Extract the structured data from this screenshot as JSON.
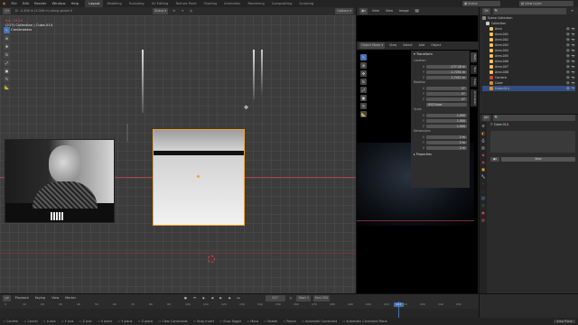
{
  "menu": {
    "items": [
      "File",
      "Edit",
      "Render",
      "Window",
      "Help"
    ]
  },
  "workspaces": [
    "Layout",
    "Modeling",
    "Sculpting",
    "UV Editing",
    "Texture Paint",
    "Shading",
    "Animation",
    "Rendering",
    "Compositing",
    "Scripting"
  ],
  "scene": {
    "label": "Scene",
    "view_layer": "View Layer"
  },
  "viewport": {
    "mode": "Object Mode",
    "orientation": "Global",
    "menus": [
      "View",
      "Select",
      "Add",
      "Object"
    ],
    "options": "Options",
    "info_line": "D: -4.306 m (4.306 m) along global X",
    "overlay_fps": "fps: 19.20",
    "overlay_collection": "(217) Collection | Cube.014",
    "overlay_units": "10 Centimeters"
  },
  "camera_view": {
    "menus": [
      "View",
      "Select",
      "Add",
      "Object"
    ],
    "mode": "Object Mode",
    "orientation": "Global",
    "header_menus": [
      "View",
      "View",
      "Image"
    ]
  },
  "n_panel": {
    "title": "Transform",
    "location_label": "Location",
    "location": [
      {
        "axis": "X",
        "value": "-177.18 m"
      },
      {
        "axis": "Y",
        "value": "-1.7251 m"
      },
      {
        "axis": "Z",
        "value": "1.7411 m"
      }
    ],
    "rotation_label": "Rotation",
    "rotation": [
      {
        "axis": "X",
        "value": "0°"
      },
      {
        "axis": "Y",
        "value": "0°"
      },
      {
        "axis": "Z",
        "value": "0°"
      }
    ],
    "rotation_mode": "XYZ Euler",
    "scale_label": "Scale",
    "scale": [
      {
        "axis": "X",
        "value": "1.000"
      },
      {
        "axis": "Y",
        "value": "1.000"
      },
      {
        "axis": "Z",
        "value": "1.000"
      }
    ],
    "dimensions_label": "Dimensions",
    "dimensions": [
      {
        "axis": "X",
        "value": "2 m"
      },
      {
        "axis": "Y",
        "value": "2 m"
      },
      {
        "axis": "Z",
        "value": "2 m"
      }
    ],
    "properties_label": "Properties",
    "tabs": [
      "Item",
      "Tool",
      "View",
      "Animation"
    ]
  },
  "outliner": {
    "root": "Scene Collection",
    "collection": "Collection",
    "items": [
      "Area",
      "Area.001",
      "Area.002",
      "Area.003",
      "Area.004",
      "Area.005",
      "Area.006",
      "Area.007",
      "Area.008",
      "Camera",
      "Cube",
      "Cube.014"
    ]
  },
  "properties": {
    "object_name": "Cube.014",
    "new_button": "New"
  },
  "timeline": {
    "menus": [
      "Playback",
      "Keying",
      "View",
      "Marker"
    ],
    "current_frame": "217",
    "start_label": "Start",
    "start": "1",
    "end_label": "End",
    "end": "250",
    "ticks": [
      "0",
      "10",
      "20",
      "30",
      "40",
      "50",
      "60",
      "70",
      "80",
      "90",
      "100",
      "110",
      "120",
      "130",
      "140",
      "150",
      "160",
      "170",
      "180",
      "190",
      "200",
      "210",
      "220",
      "230",
      "240",
      "250"
    ]
  },
  "status_bar": {
    "items": [
      "Confirm",
      "Cancel",
      "X axis",
      "Y axis",
      "Z axis",
      "X plane",
      "Y plane",
      "Z plane",
      "Clear Constraints",
      "Snap Invert",
      "Snap Toggle",
      "Move",
      "Rotate",
      "Resize",
      "Automatic Constraint",
      "Automatic Constraint Plane"
    ],
    "right": "Area Plane"
  },
  "colors": {
    "accent": "#4772b3",
    "selected": "#f5a524",
    "red_axis": "#a8424e",
    "timeline_cursor": "#4772b3"
  }
}
